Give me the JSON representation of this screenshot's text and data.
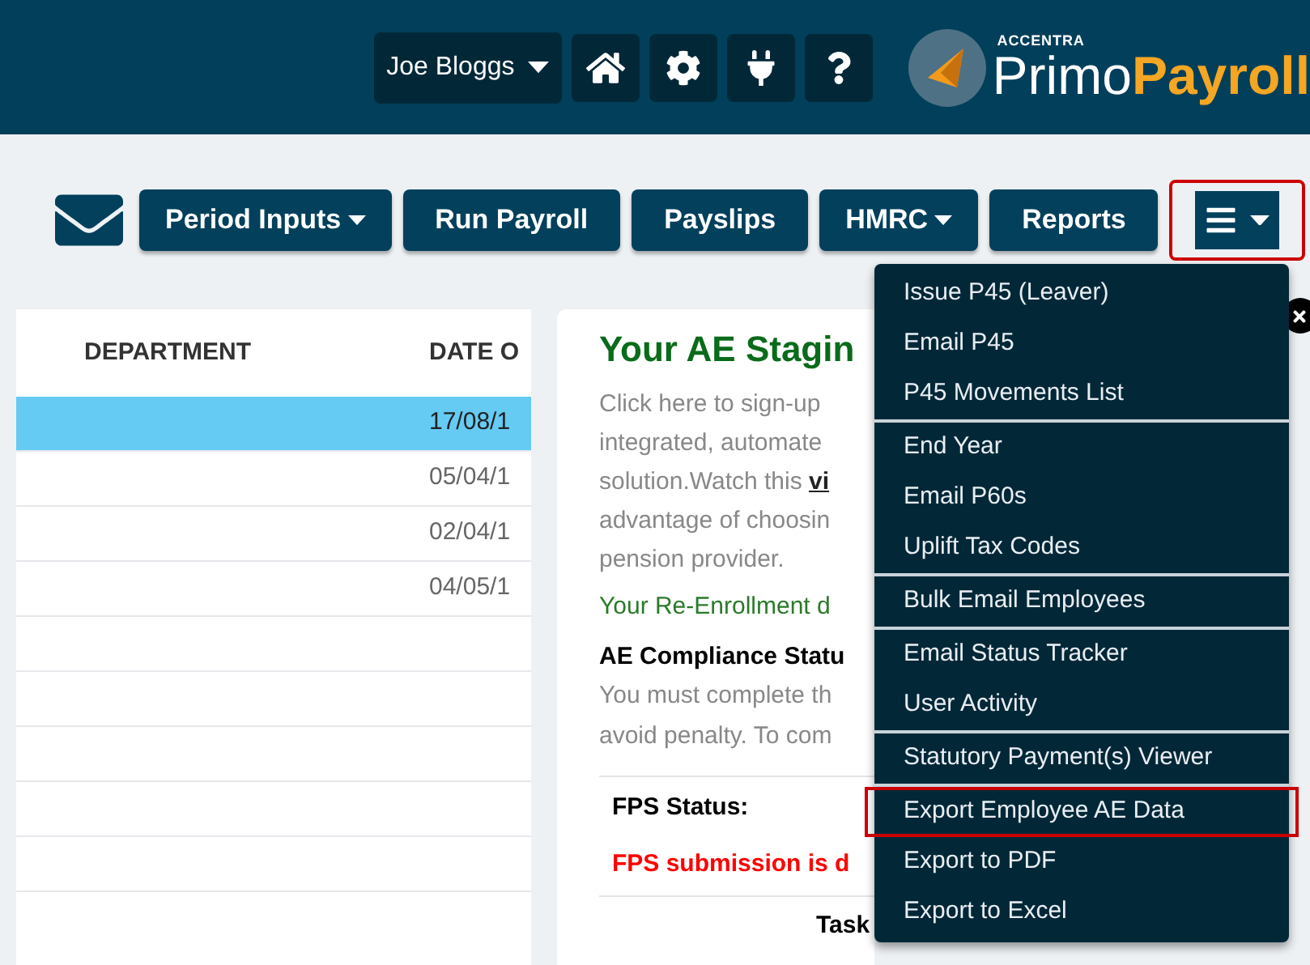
{
  "header": {
    "user_menu": "Joe Bloggs",
    "logo": {
      "brand": "ACCENTRA",
      "name_part_1": "Primo",
      "name_part_2": "Payroll"
    }
  },
  "toolbar": {
    "buttons": [
      {
        "label": "Period Inputs",
        "kind": "dropdown"
      },
      {
        "label": "Run Payroll",
        "kind": "plain"
      },
      {
        "label": "Payslips",
        "kind": "plain"
      },
      {
        "label": "HMRC",
        "kind": "dropdown"
      },
      {
        "label": "Reports",
        "kind": "plain"
      }
    ],
    "menu_button": {
      "highlighted": true
    }
  },
  "table": {
    "columns": [
      "DEPARTMENT",
      "DATE O"
    ],
    "rows": [
      {
        "cells": [
          "",
          "17/08/1"
        ],
        "selected": true
      },
      {
        "cells": [
          "",
          "05/04/1"
        ],
        "selected": false
      },
      {
        "cells": [
          "",
          "02/04/1"
        ],
        "selected": false
      },
      {
        "cells": [
          "",
          "04/05/1"
        ],
        "selected": false
      },
      {
        "cells": [
          "",
          ""
        ],
        "selected": false
      },
      {
        "cells": [
          "",
          ""
        ],
        "selected": false
      },
      {
        "cells": [
          "",
          ""
        ],
        "selected": false
      },
      {
        "cells": [
          "",
          ""
        ],
        "selected": false
      },
      {
        "cells": [
          "",
          ""
        ],
        "selected": false
      }
    ]
  },
  "ae_panel": {
    "title": "Your AE Stagin",
    "intro_lines": [
      "Click here to sign-up",
      "integrated, automate",
      "solution.Watch this ",
      "advantage of choosin",
      "pension provider."
    ],
    "intro_link": "vi",
    "re_enrollment": "Your Re-Enrollment d",
    "compliance_title": "AE Compliance Statu",
    "compliance_lines": [
      "You must complete th",
      "avoid penalty. To com"
    ],
    "fps_label": "FPS Status:",
    "fps_message": "FPS submission is d",
    "tasks_label": "Task"
  },
  "menu": {
    "groups": [
      [
        {
          "label": "Issue P45 (Leaver)",
          "highlighted": false
        },
        {
          "label": "Email P45",
          "highlighted": false
        },
        {
          "label": "P45 Movements List",
          "highlighted": false
        }
      ],
      [
        {
          "label": "End Year",
          "highlighted": false
        },
        {
          "label": "Email P60s",
          "highlighted": false
        },
        {
          "label": "Uplift Tax Codes",
          "highlighted": false
        }
      ],
      [
        {
          "label": "Bulk Email Employees",
          "highlighted": false
        }
      ],
      [
        {
          "label": "Email Status Tracker",
          "highlighted": false
        },
        {
          "label": "User Activity",
          "highlighted": false
        }
      ],
      [
        {
          "label": "Statutory Payment(s) Viewer",
          "highlighted": false
        }
      ],
      [
        {
          "label": "Export Employee AE Data",
          "highlighted": true
        },
        {
          "label": "Export to PDF",
          "highlighted": false
        },
        {
          "label": "Export to Excel",
          "highlighted": false
        }
      ]
    ]
  }
}
